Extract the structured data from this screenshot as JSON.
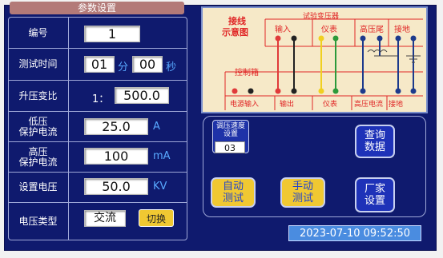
{
  "title": "参数设置",
  "params": [
    {
      "label": "编号",
      "value": "1"
    },
    {
      "label": "测试时间",
      "minutes": "01",
      "min_unit": "分",
      "seconds": "00",
      "sec_unit": "秒"
    },
    {
      "label": "升压变比",
      "prefix": "1：",
      "value": "500.0"
    },
    {
      "label_line1": "低压",
      "label_line2": "保护电流",
      "value": "25.0",
      "unit": "A"
    },
    {
      "label_line1": "高压",
      "label_line2": "保护电流",
      "value": "100",
      "unit": "mA"
    },
    {
      "label": "设置电压",
      "value": "50.0",
      "unit": "KV"
    },
    {
      "label": "电压类型",
      "value": "交流",
      "button": "切换"
    }
  ],
  "diagram": {
    "title_line1": "接线",
    "title_line2": "示意图",
    "transformer_label": "试验变压器",
    "top_labels": [
      "输入",
      "仪表",
      "高压尾",
      "接地"
    ],
    "control_box_label": "控制箱",
    "bottom_labels": [
      "电源输入",
      "输出",
      "仪表",
      "高压电流",
      "接地"
    ]
  },
  "speed": {
    "label_line1": "调压速度",
    "label_line2": "设置",
    "value": "03"
  },
  "buttons": {
    "query": {
      "line1": "查询",
      "line2": "数据"
    },
    "auto": {
      "line1": "自动",
      "line2": "测试"
    },
    "manual": {
      "line1": "手动",
      "line2": "测试"
    },
    "factory": {
      "line1": "厂家",
      "line2": "设置"
    }
  },
  "datetime": "2023-07-10 09:52:50",
  "colors": {
    "screen_bg": "#0f1a6e",
    "title_bg": "#b37a78",
    "unit_text": "#58a8ff",
    "button_blue": "#1e32b8",
    "button_yellow": "#f0c832",
    "diagram_bg": "#f6e9c8",
    "diagram_text": "#e02626"
  }
}
